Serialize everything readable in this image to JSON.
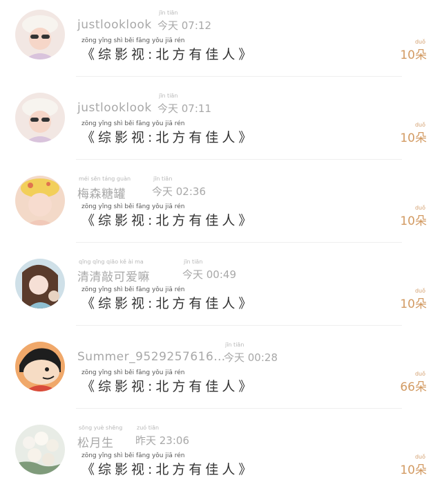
{
  "rows": [
    {
      "username": "justlooklook",
      "time_pinyin": "jīn tiān",
      "time": "今天 07:12",
      "title_pinyin": "zōng yǐng shì   běi fāng yǒu jiā rén",
      "title": "《综影视:北方有佳人》",
      "gift_pinyin": "duǒ",
      "gift": "10朵",
      "avatar": "avatar-girl-hat",
      "avatar_color": "#f2e7e3"
    },
    {
      "username": "justlooklook",
      "time_pinyin": "jīn tiān",
      "time": "今天 07:11",
      "title_pinyin": "zōng yǐng shì   běi fāng yǒu jiā rén",
      "title": "《综影视:北方有佳人》",
      "gift_pinyin": "duǒ",
      "gift": "10朵",
      "avatar": "avatar-girl-hat",
      "avatar_color": "#f2e7e3"
    },
    {
      "username": "梅森糖罐",
      "username_pinyin": "méi sēn táng guàn",
      "time_pinyin": "jīn tiān",
      "time": "今天 02:36",
      "title_pinyin": "zōng yǐng shì   běi fāng yǒu jiā rén",
      "title": "《综影视:北方有佳人》",
      "gift_pinyin": "duǒ",
      "gift": "10朵",
      "avatar": "avatar-girl-yellow-hat",
      "avatar_color": "#f3d9c8"
    },
    {
      "username": "清清敲可爱嘛",
      "username_pinyin": "qīng qīng qiāo kě ài ma",
      "time_pinyin": "jīn tiān",
      "time": "今天 00:49",
      "title_pinyin": "zōng yǐng shì   běi fāng yǒu jiā rén",
      "title": "《综影视:北方有佳人》",
      "gift_pinyin": "duǒ",
      "gift": "10朵",
      "avatar": "avatar-anime-girl",
      "avatar_color": "#cfe0e8"
    },
    {
      "username": "Summer_9529257616…",
      "time_pinyin": "jīn tiān",
      "time": "今天 00:28",
      "title_pinyin": "zōng yǐng shì   běi fāng yǒu jiā rén",
      "title": "《综影视:北方有佳人》",
      "gift_pinyin": "duǒ",
      "gift": "66朵",
      "avatar": "avatar-cartoon-boy",
      "avatar_color": "#f0a86a"
    },
    {
      "username": "松月生",
      "username_pinyin": "sōng yuè shēng",
      "time_pinyin": "zuó tiān",
      "time": "昨天 23:06",
      "title_pinyin": "zōng yǐng shì   běi fāng yǒu jiā rén",
      "title": "《综影视:北方有佳人》",
      "gift_pinyin": "duǒ",
      "gift": "10朵",
      "avatar": "avatar-flowers",
      "avatar_color": "#e8ece6"
    }
  ]
}
